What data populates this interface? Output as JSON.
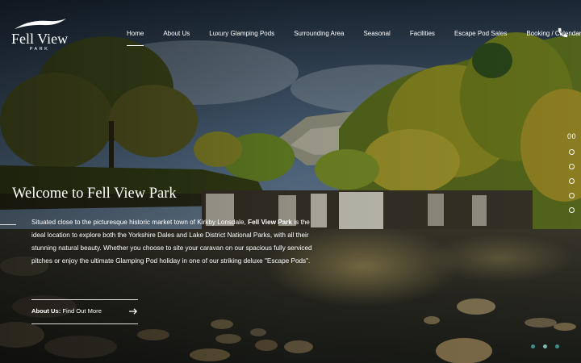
{
  "brand": {
    "name": "Fell View",
    "subtitle": "PARK"
  },
  "nav": {
    "items": [
      {
        "label": "Home",
        "active": true
      },
      {
        "label": "About Us"
      },
      {
        "label": "Luxury Glamping Pods"
      },
      {
        "label": "Surrounding Area"
      },
      {
        "label": "Seasonal"
      },
      {
        "label": "Facilities"
      },
      {
        "label": "Escape Pod Sales"
      },
      {
        "label": "Booking / Calendar"
      }
    ],
    "phone_icon": "phone-icon"
  },
  "side_nav": {
    "slide_number": "00",
    "dots": 5,
    "active_index": 0
  },
  "hero": {
    "title": "Welcome to Fell View Park",
    "text_1": "Situated close to the picturesque historic market town of Kirkby Lonsdale, ",
    "text_bold": "Fell View Park",
    "text_2": " is the ideal location to explore both the Yorkshire Dales and Lake District National Parks, with all their stunning natural beauty.  Whether you choose to site your caravan on our spacious fully serviced pitches or enjoy the ultimate Glamping Pod holiday in one of our striking deluxe \"Escape Pods\".",
    "cta_bold": "About Us:",
    "cta_text": " Find Out More"
  },
  "slider": {
    "dots": 3,
    "active_index": 1
  },
  "colors": {
    "accent": "#3f8f86",
    "accent_active": "#7fb8b1"
  }
}
